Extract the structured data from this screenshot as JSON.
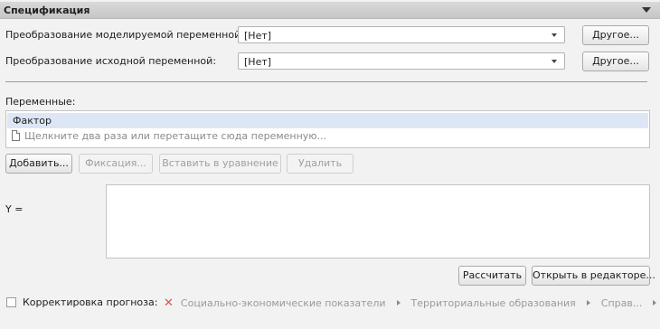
{
  "panel": {
    "title": "Спецификация"
  },
  "transform_model": {
    "label": "Преобразование моделируемой переменной:",
    "value": "[Нет]",
    "other_button": "Другое..."
  },
  "transform_source": {
    "label": "Преобразование исходной переменной:",
    "value": "[Нет]",
    "other_button": "Другое..."
  },
  "variables": {
    "label": "Переменные:",
    "items": [
      "Фактор"
    ],
    "drop_hint": "Щелкните два раза или перетащите сюда переменную..."
  },
  "var_buttons": {
    "add": "Добавить...",
    "fix": "Фиксация...",
    "insert": "Вставить в уравнение",
    "delete": "Удалить"
  },
  "equation": {
    "label": "Y =",
    "value": ""
  },
  "actions": {
    "calculate": "Рассчитать",
    "open_editor": "Открыть в редакторе..."
  },
  "forecast": {
    "checkbox_label": "Корректировка прогноза:",
    "checked": false,
    "breadcrumbs": [
      "Социально-экономические показатели",
      "Территориальные образования",
      "Справ..."
    ],
    "expand_symbol": "▸▸"
  },
  "icons": {
    "collapse": "chevron-down-icon",
    "remove": "close-icon",
    "document": "document-icon"
  },
  "colors": {
    "header_bg": "#cdcdcd",
    "selected_row": "#dde6f4",
    "remove_icon": "#d9534f"
  }
}
